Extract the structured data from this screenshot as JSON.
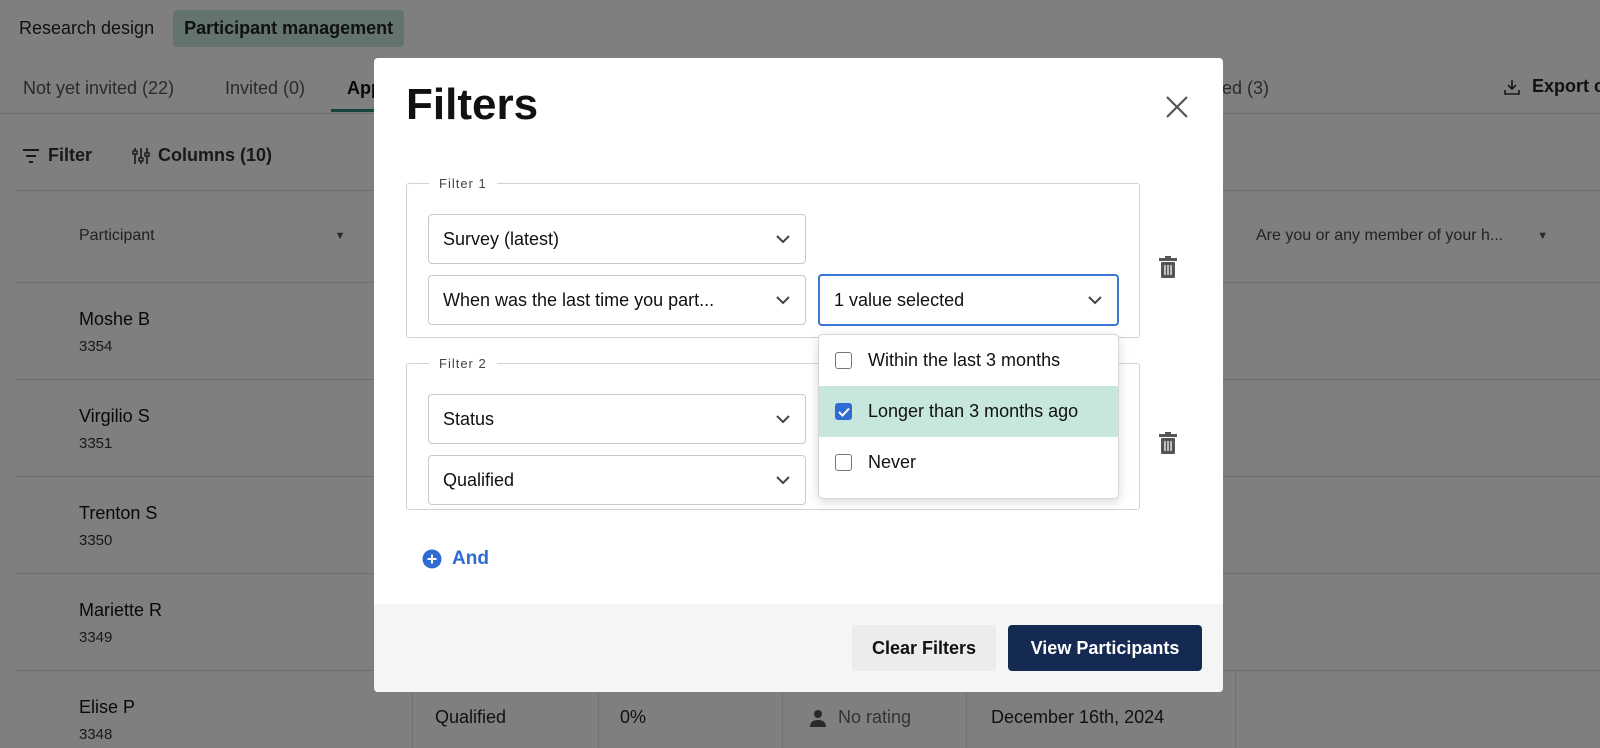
{
  "top_tabs": [
    {
      "label": "Research design"
    },
    {
      "label": "Participant management"
    }
  ],
  "sub_tabs": [
    {
      "label": "Not yet invited (22)"
    },
    {
      "label": "Invited (0)"
    },
    {
      "label": "App"
    },
    {
      "label": "ed (3)"
    }
  ],
  "export_label": "Export c",
  "toolbar": {
    "filter_label": "Filter",
    "columns_label": "Columns (10)"
  },
  "table": {
    "headers": {
      "participant": "Participant",
      "question": "Are you or any member of your h..."
    },
    "rows": [
      {
        "name": "Moshe B",
        "id": "3354"
      },
      {
        "name": "Virgilio S",
        "id": "3351"
      },
      {
        "name": "Trenton S",
        "id": "3350"
      },
      {
        "name": "Mariette R",
        "id": "3349"
      },
      {
        "name": "Elise P",
        "id": "3348",
        "status": "Qualified",
        "percent": "0%",
        "rating": "No rating",
        "date": "December 16th, 2024"
      }
    ]
  },
  "modal": {
    "title": "Filters",
    "filter1": {
      "legend": "Filter 1",
      "source": "Survey (latest)",
      "question": "When was the last time you part...",
      "value": "1 value selected"
    },
    "filter2": {
      "legend": "Filter 2",
      "field": "Status",
      "value": "Qualified"
    },
    "dropdown_options": [
      {
        "label": "Within the last 3 months",
        "checked": false
      },
      {
        "label": "Longer than 3 months ago",
        "checked": true
      },
      {
        "label": "Never",
        "checked": false
      }
    ],
    "and_label": "And",
    "clear_label": "Clear Filters",
    "view_label": "View Participants"
  },
  "colors": {
    "accent_blue": "#2f6bd0",
    "primary_navy": "#152a52",
    "selected_mint": "#c7e6de"
  }
}
